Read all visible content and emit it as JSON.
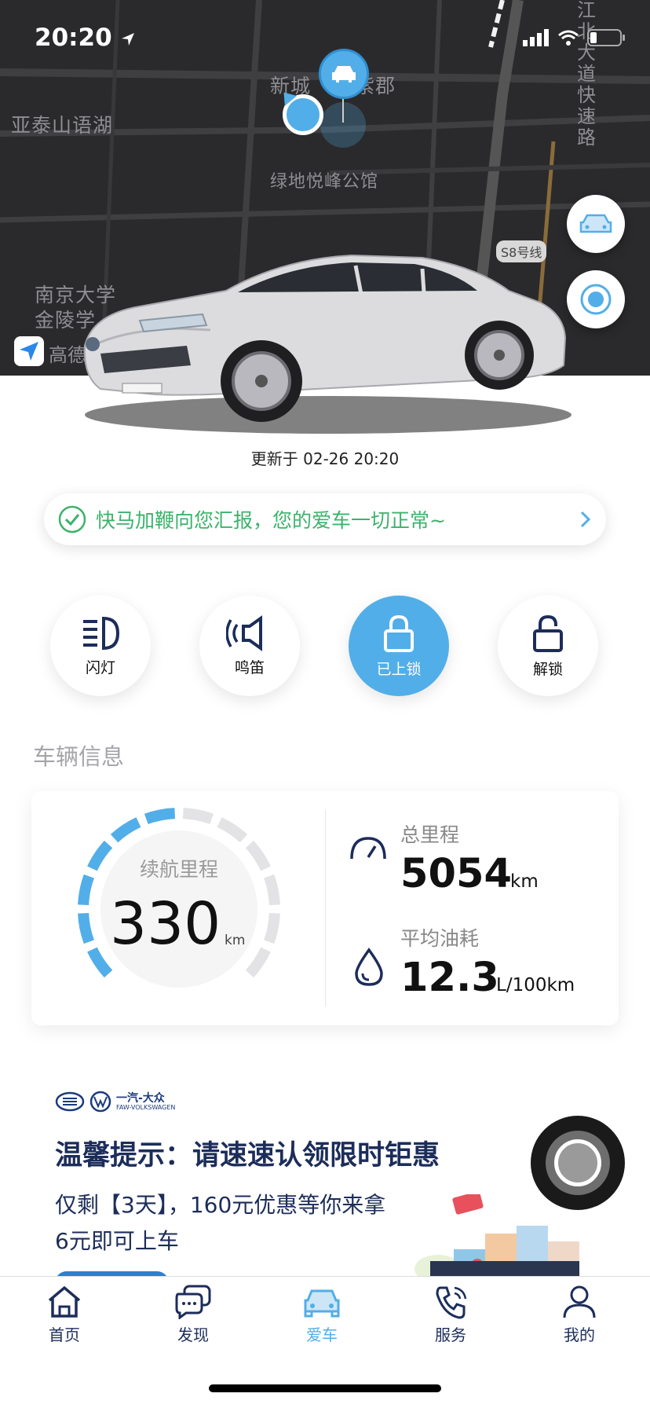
{
  "status_bar": {
    "time": "20:20"
  },
  "map": {
    "labels": {
      "xincheng": "新城",
      "zijun": "紫郡",
      "yatai": "亚泰山语湖",
      "lvdi": "绿地悦峰公馆",
      "nanjing1": "南京大学",
      "nanjing2": "金陵学",
      "expressway": "江北大道快速路",
      "metro": "S8号线",
      "amap": "高德"
    }
  },
  "updated": "更新于 02-26 20:20",
  "status_message": "快马加鞭向您汇报，您的爱车一切正常~",
  "controls": [
    {
      "label": "闪灯",
      "active": false
    },
    {
      "label": "鸣笛",
      "active": false
    },
    {
      "label": "已上锁",
      "active": true
    },
    {
      "label": "解锁",
      "active": false
    }
  ],
  "section_title": "车辆信息",
  "vehicle_info": {
    "range_label": "续航里程",
    "range_value": "330",
    "range_unit": "km",
    "range_fraction": 0.5,
    "mileage_label": "总里程",
    "mileage_value": "5054",
    "mileage_unit": "km",
    "fuel_label": "平均油耗",
    "fuel_value": "12.3",
    "fuel_unit": "L/100km"
  },
  "promo": {
    "brand": "一汽-大众",
    "brand_sub": "FAW-VOLKSWAGEN",
    "title": "温馨提示：请速速认领限时钜惠",
    "line1": "仅剩【3天】，160元优惠等你来拿",
    "line2": "6元即可上车"
  },
  "tabs": [
    {
      "label": "首页",
      "icon": "home-icon"
    },
    {
      "label": "发现",
      "icon": "chat-icon"
    },
    {
      "label": "爱车",
      "icon": "car-icon"
    },
    {
      "label": "服务",
      "icon": "phone-icon"
    },
    {
      "label": "我的",
      "icon": "user-icon"
    }
  ],
  "colors": {
    "accent": "#52aee8",
    "ok_green": "#3cb36b",
    "navy": "#1c2d5a"
  }
}
